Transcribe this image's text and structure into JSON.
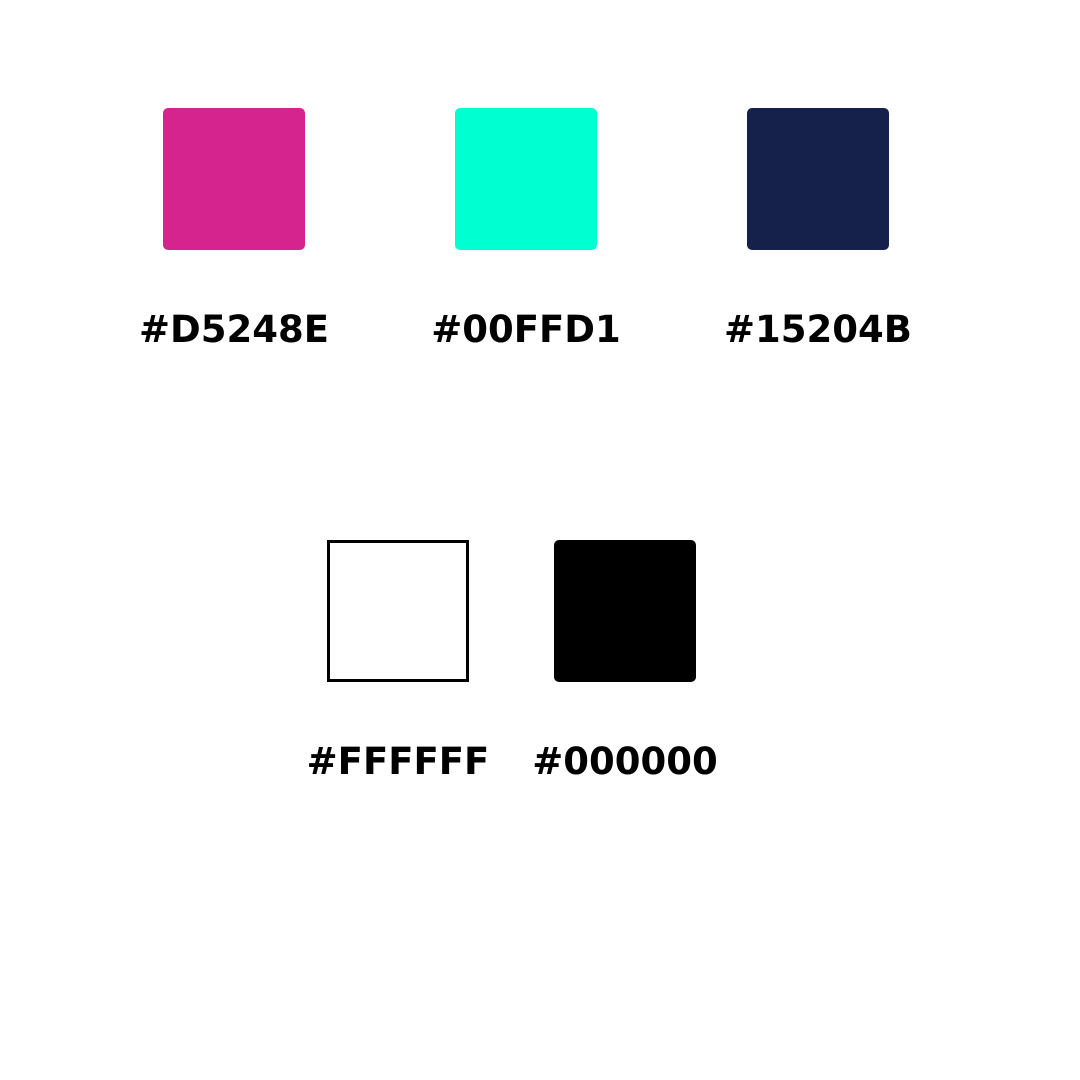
{
  "palette": {
    "swatches": [
      {
        "hex": "#D5248E",
        "color": "#D5248E",
        "outlined": false
      },
      {
        "hex": "#00FFD1",
        "color": "#00FFD1",
        "outlined": false
      },
      {
        "hex": "#15204B",
        "color": "#15204B",
        "outlined": false
      },
      {
        "hex": "#FFFFFF",
        "color": "#FFFFFF",
        "outlined": true
      },
      {
        "hex": "#000000",
        "color": "#000000",
        "outlined": false
      }
    ]
  }
}
